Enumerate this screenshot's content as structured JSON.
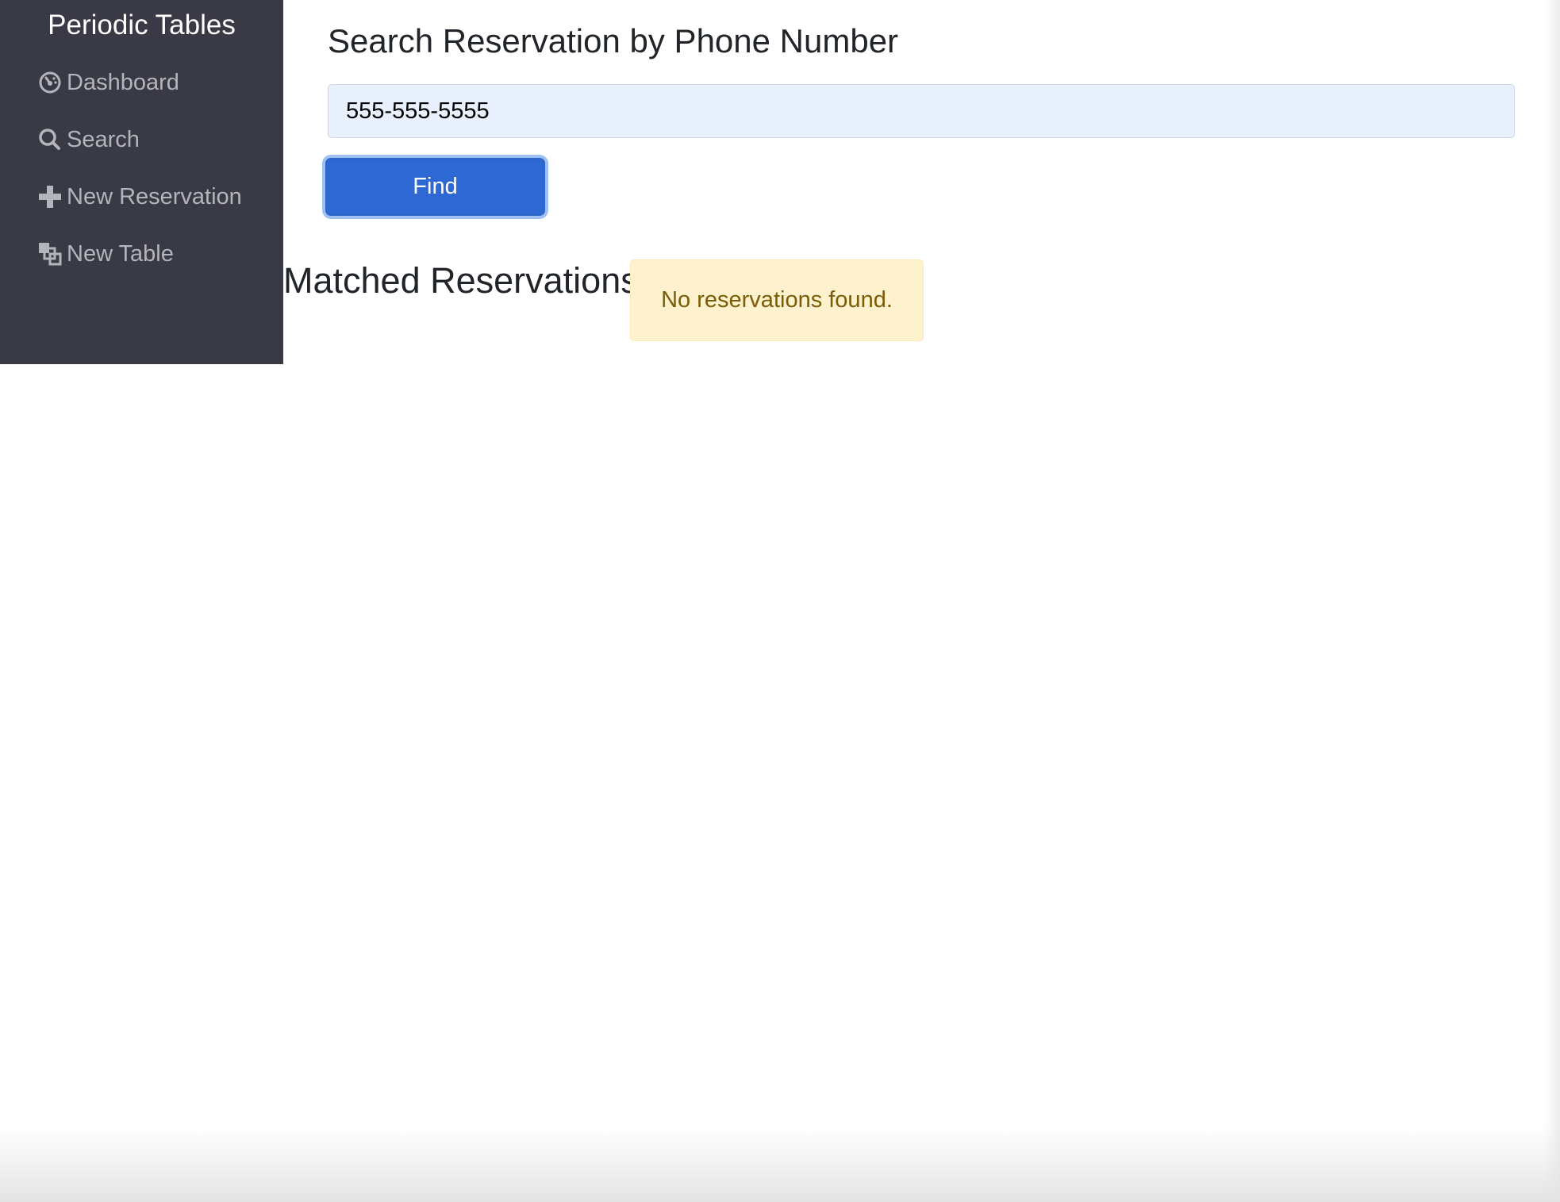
{
  "sidebar": {
    "brand": "Periodic Tables",
    "items": [
      {
        "label": "Dashboard",
        "icon": "dashboard-icon"
      },
      {
        "label": "Search",
        "icon": "search-icon"
      },
      {
        "label": "New Reservation",
        "icon": "plus-icon"
      },
      {
        "label": "New Table",
        "icon": "new-table-icon"
      }
    ]
  },
  "main": {
    "title": "Search Reservation by Phone Number",
    "phone_input": {
      "value": "555-555-5555"
    },
    "find_label": "Find",
    "results_heading": "Matched Reservations:",
    "empty_message": "No reservations found."
  },
  "colors": {
    "sidebar_bg": "#3a3a46",
    "primary": "#2d68d4",
    "alert_bg": "#fdf2cd",
    "alert_text": "#7a5b07"
  }
}
